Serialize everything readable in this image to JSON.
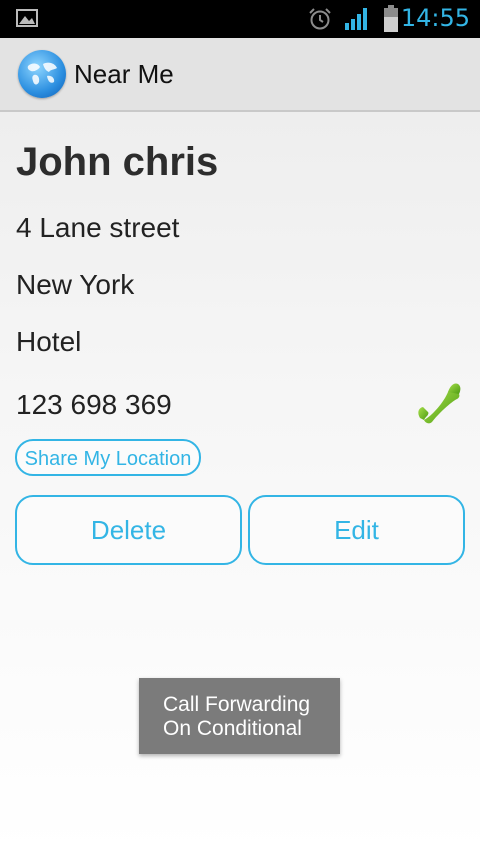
{
  "status_bar": {
    "time": "14:55",
    "icons": [
      "gallery-icon",
      "alarm-icon",
      "signal-icon",
      "battery-icon"
    ],
    "accent_color": "#33b5e5"
  },
  "action_bar": {
    "title": "Near Me",
    "icon": "globe-icon"
  },
  "place": {
    "name": "John chris",
    "address": "4 Lane street",
    "city": "New York",
    "category": "Hotel",
    "phone": "123 698 369",
    "phone_icon": "phone-icon"
  },
  "buttons": {
    "share": "Share My Location",
    "delete": "Delete",
    "edit": "Edit"
  },
  "toast": {
    "line1": "Call Forwarding",
    "line2": "On Conditional"
  }
}
